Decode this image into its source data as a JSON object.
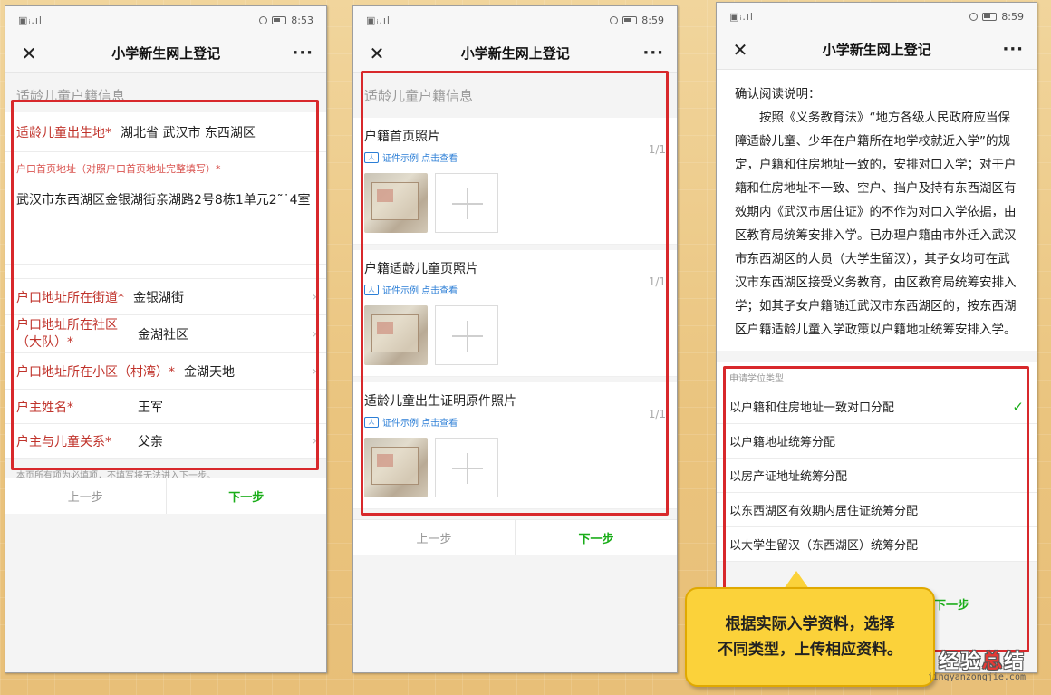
{
  "status_bar": {
    "signal": "▣ᵢ.ıl",
    "time1": "8:53",
    "time2": "8:59",
    "time3": "8:59"
  },
  "app": {
    "title": "小学新生网上登记",
    "close": "✕",
    "more": "···"
  },
  "phone1": {
    "section": "适龄儿童户籍信息",
    "birthplace_label": "适龄儿童出生地*",
    "birthplace_value": "湖北省 武汉市 东西湖区",
    "address_hint": "户口首页地址（对照户口首页地址完整填写）*",
    "address_value": "武汉市东西湖区金银湖街亲湖路2号8栋1单元2˜˙4室",
    "street_label": "户口地址所在街道*",
    "street_value": "金银湖街",
    "community_label": "户口地址所在社区（大队）*",
    "community_value": "金湖社区",
    "estate_label": "户口地址所在小区（村湾）*",
    "estate_value": "金湖天地",
    "owner_label": "户主姓名*",
    "owner_value": "王军",
    "relation_label": "户主与儿童关系*",
    "relation_value": "父亲",
    "note": "本页所有项为必填项，不填写将无法进入下一步。",
    "prev": "上一步",
    "next": "下一步"
  },
  "phone2": {
    "section": "适龄儿童户籍信息",
    "uploads": [
      {
        "title": "户籍首页照片",
        "sample": "证件示例 点击查看",
        "count": "1/1"
      },
      {
        "title": "户籍适龄儿童页照片",
        "sample": "证件示例 点击查看",
        "count": "1/1"
      },
      {
        "title": "适龄儿童出生证明原件照片",
        "sample": "证件示例 点击查看",
        "count": "1/1"
      }
    ],
    "prev": "上一步",
    "next": "下一步"
  },
  "phone3": {
    "heading": "确认阅读说明：",
    "body": "按照《义务教育法》“地方各级人民政府应当保障适龄儿童、少年在户籍所在地学校就近入学”的规定，户籍和住房地址一致的，安排对口入学；对于户籍和住房地址不一致、空户、挡户及持有东西湖区有效期内《武汉市居住证》的不作为对口入学依据，由区教育局统筹安排入学。已办理户籍由市外迁入武汉市东西湖区的人员（大学生留汉），其子女均可在武汉市东西湖区接受义务教育，由区教育局统筹安排入学；如其子女户籍随迁武汉市东西湖区的，按东西湖区户籍适龄儿童入学政策以户籍地址统筹安排入学。",
    "options_head": "申请学位类型",
    "options": [
      "以户籍和住房地址一致对口分配",
      "以户籍地址统筹分配",
      "以房产证地址统筹分配",
      "以东西湖区有效期内居住证统筹分配",
      "以大学生留汉（东西湖区）统筹分配"
    ],
    "selected_mark": "✓",
    "next": "下一步"
  },
  "callout": {
    "line1": "根据实际入学资料，选择",
    "line2": "不同类型，上传相应资料。"
  },
  "watermark": {
    "brand_a": "经验",
    "brand_b": "总",
    "brand_c": "结",
    "url": "jingyanzongjie.com"
  },
  "colors": {
    "accent_red": "#d8282b",
    "green": "#1aad19",
    "link_blue": "#2b7ed6",
    "callout_yellow": "#fbd23a"
  }
}
